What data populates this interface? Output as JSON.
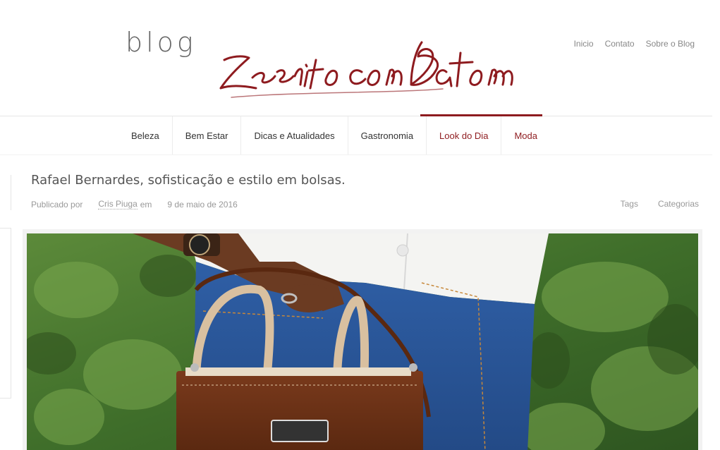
{
  "header": {
    "blog_word": "blog",
    "logo_text": "Escrito com Batom",
    "top_links": [
      "Inicio",
      "Contato",
      "Sobre o Blog"
    ]
  },
  "nav": {
    "items": [
      "Beleza",
      "Bem Estar",
      "Dicas e Atualidades",
      "Gastronomia",
      "Look do Dia",
      "Moda"
    ],
    "active": "Look do Dia"
  },
  "post": {
    "title": "Rafael Bernardes, sofisticação e estilo em bolsas.",
    "published_by_label": "Publicado por",
    "author": "Cris Piuga",
    "em_label": "em",
    "date": "9 de maio de 2016",
    "tags_label": "Tags",
    "categories_label": "Categorias"
  },
  "colors": {
    "accent": "#8e1b1f",
    "muted_text": "#999999"
  }
}
